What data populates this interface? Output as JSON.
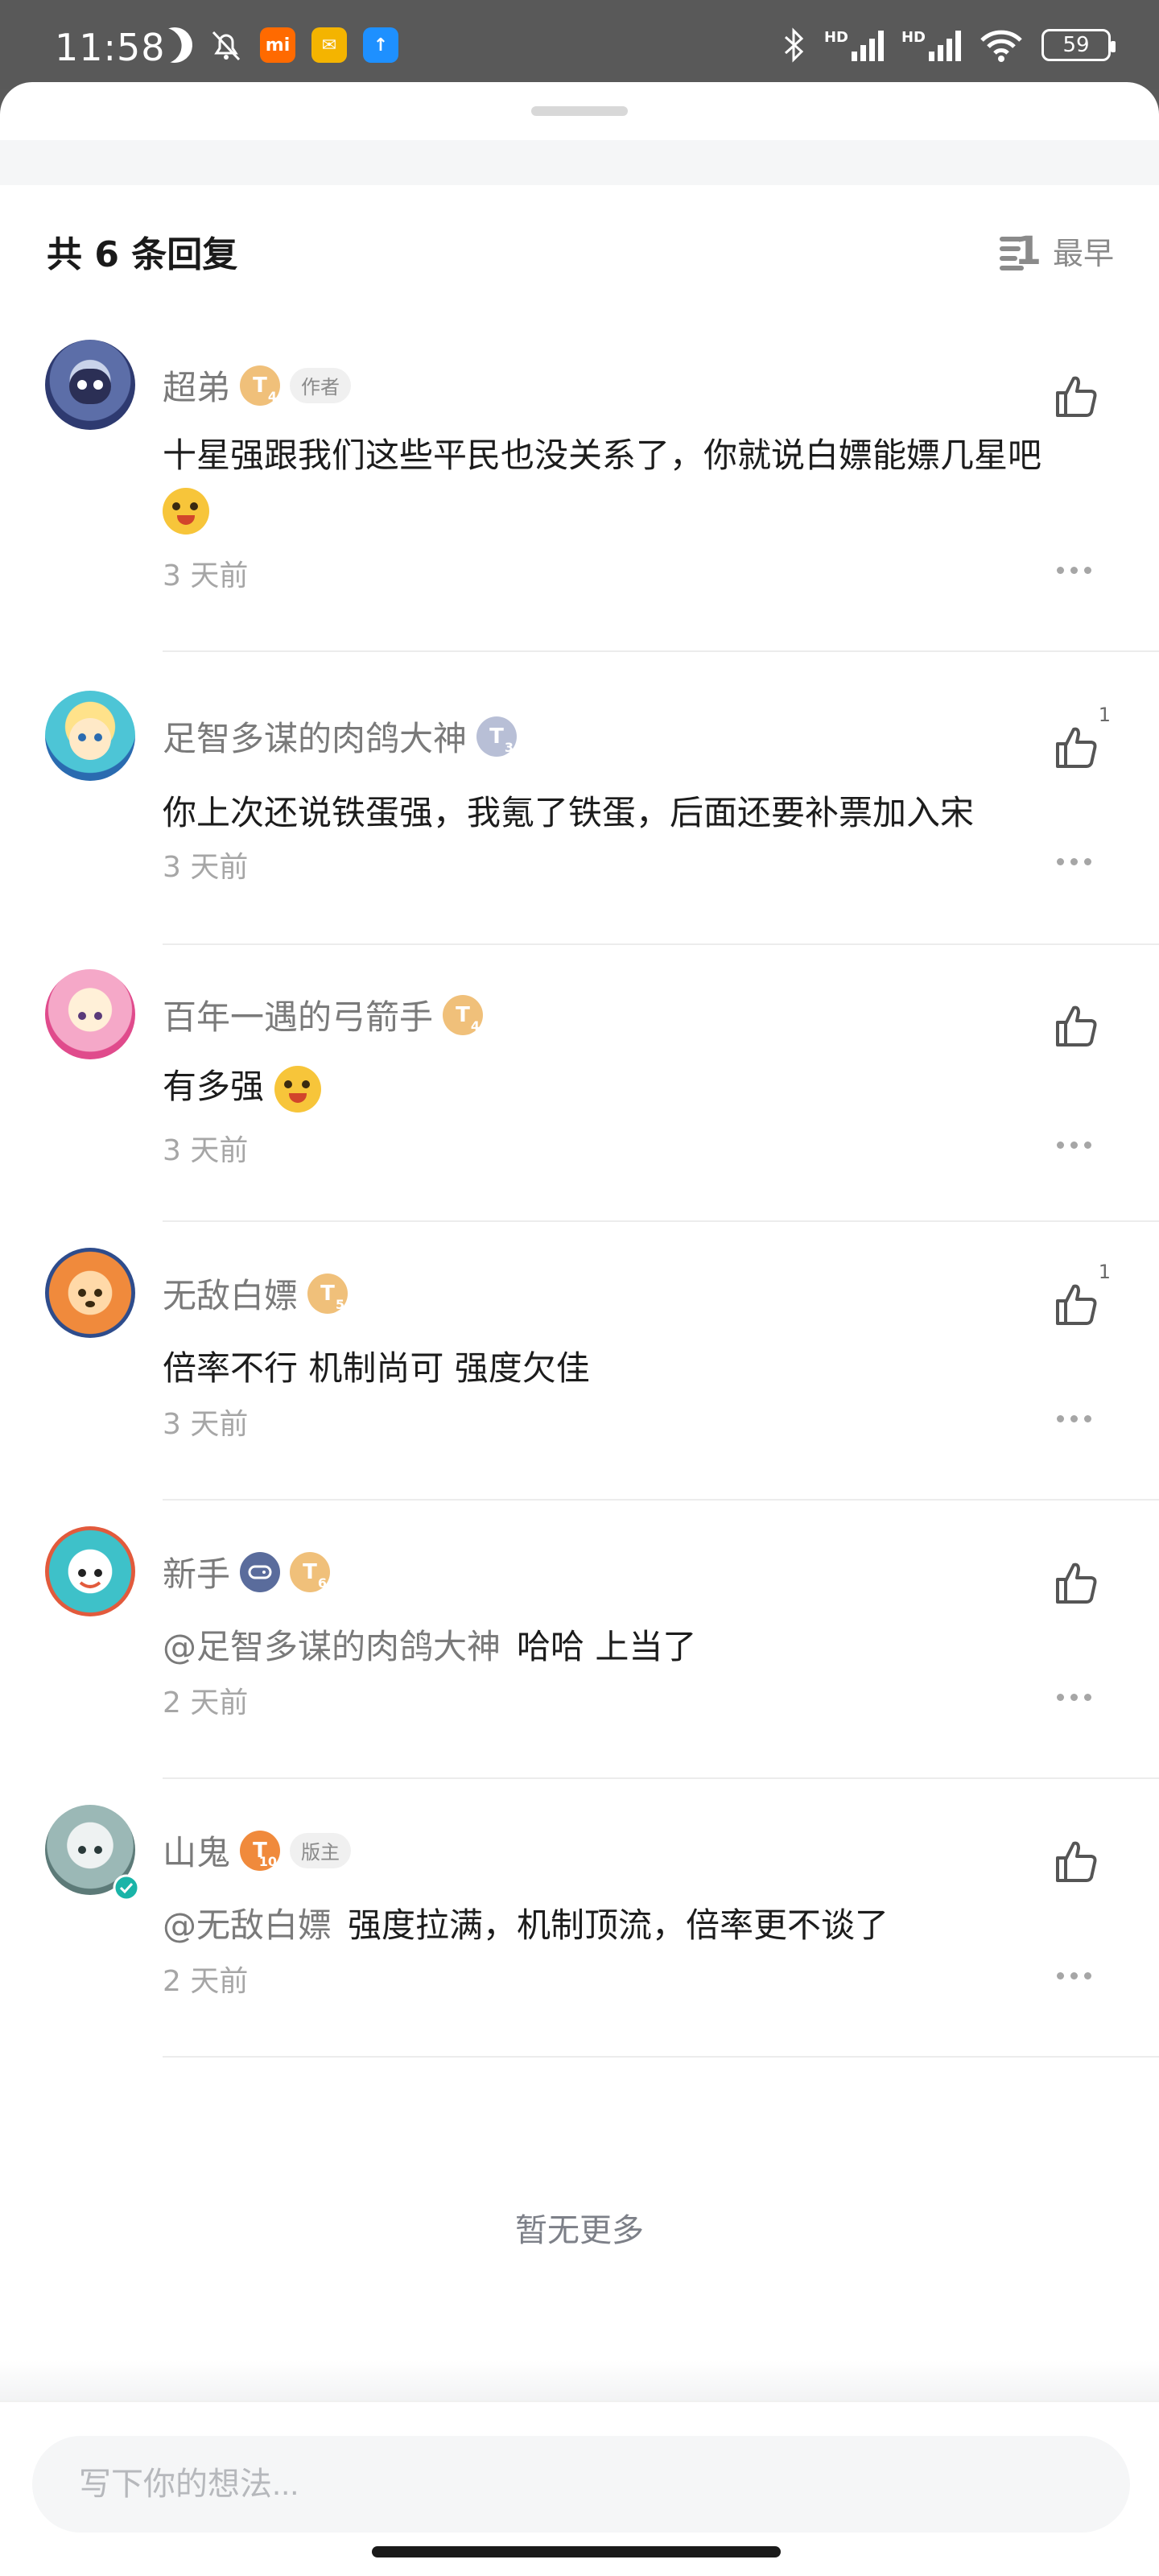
{
  "status_bar": {
    "time": "11:58",
    "app_icons": [
      "mi",
      "mail",
      "upload"
    ],
    "network_label_1": "HD",
    "network_label_2": "HD",
    "battery": "59"
  },
  "header": {
    "title": "共 6 条回复",
    "sort_label": "最早"
  },
  "comments": [
    {
      "username": "超弟",
      "level": "4",
      "tag": "作者",
      "text": "十星强跟我们这些平民也没关系了，你就说白嫖能嫖几星吧",
      "has_emoji": true,
      "time": "3 天前",
      "likes": ""
    },
    {
      "username": "足智多谋的肉鸽大神",
      "level": "3",
      "tag": "",
      "text": "你上次还说铁蛋强，我氪了铁蛋，后面还要补票加入宋",
      "time": "3 天前",
      "likes": "1"
    },
    {
      "username": "百年一遇的弓箭手",
      "level": "4",
      "tag": "",
      "text": "有多强",
      "has_emoji": true,
      "time": "3 天前",
      "likes": ""
    },
    {
      "username": "无敌白嫖",
      "level": "5",
      "tag": "",
      "text": "倍率不行 机制尚可 强度欠佳",
      "time": "3 天前",
      "likes": "1"
    },
    {
      "username": "新手",
      "level": "6",
      "tag": "",
      "mention": "@足智多谋的肉鸽大神",
      "text": "哈哈 上当了",
      "time": "2 天前",
      "likes": ""
    },
    {
      "username": "山鬼",
      "level": "10",
      "tag": "版主",
      "mention": "@无敌白嫖",
      "text": "强度拉满，机制顶流，倍率更不谈了",
      "time": "2 天前",
      "likes": ""
    }
  ],
  "footer": {
    "no_more": "暂无更多",
    "input_placeholder": "写下你的想法..."
  },
  "colors": {
    "level_gold": "#f0c07a",
    "level_silver": "#b8bfd6",
    "level_orange": "#f08a3c",
    "status_bar_bg": "#595959"
  }
}
